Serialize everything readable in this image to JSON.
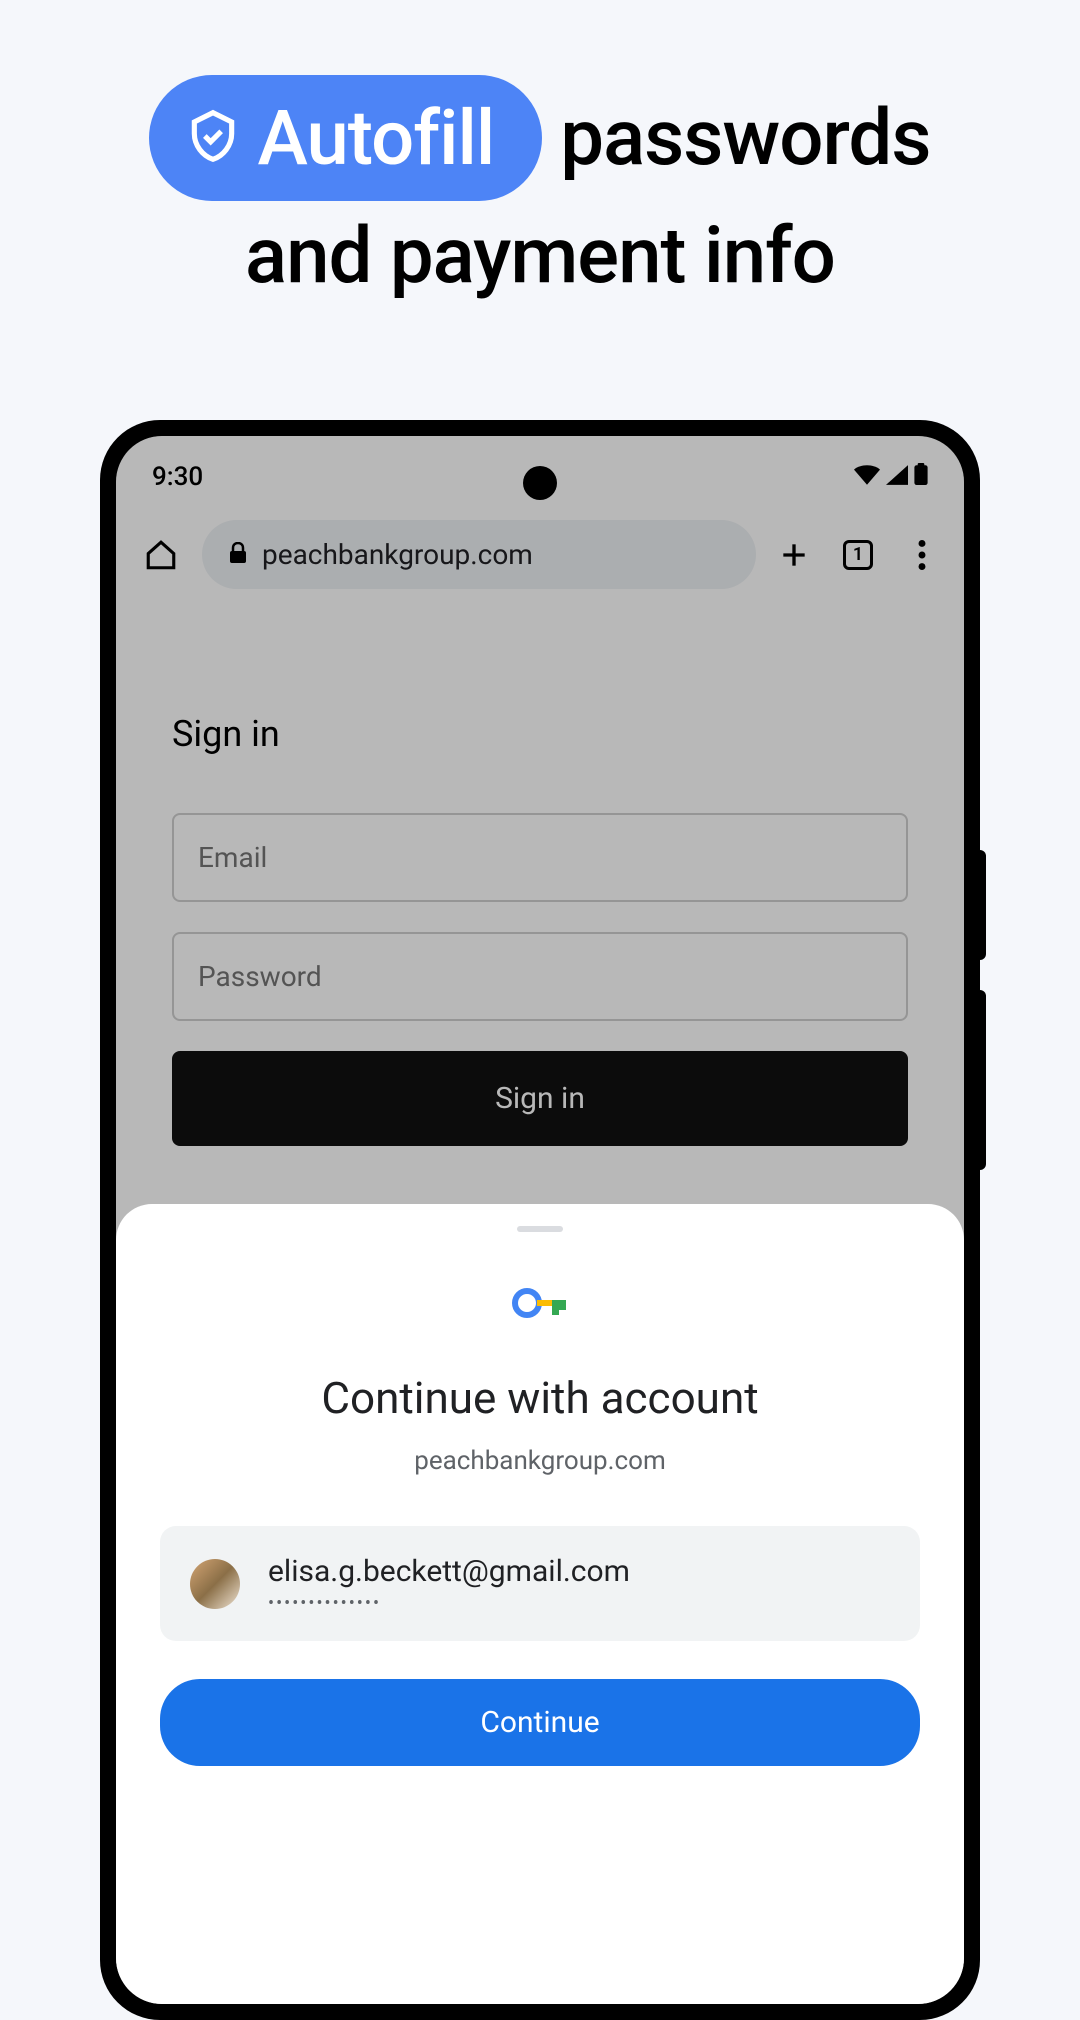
{
  "headline": {
    "pill_text": "Autofill",
    "word_passwords": "passwords",
    "line2": "and payment info"
  },
  "status": {
    "time": "9:30"
  },
  "toolbar": {
    "url": "peachbankgroup.com",
    "tab_count": "1"
  },
  "page": {
    "title": "Sign in",
    "email_placeholder": "Email",
    "password_placeholder": "Password",
    "signin_button": "Sign in"
  },
  "sheet": {
    "title": "Continue with account",
    "domain": "peachbankgroup.com",
    "account_email": "elisa.g.beckett@gmail.com",
    "password_mask": "••••••••••••••",
    "continue_button": "Continue"
  }
}
